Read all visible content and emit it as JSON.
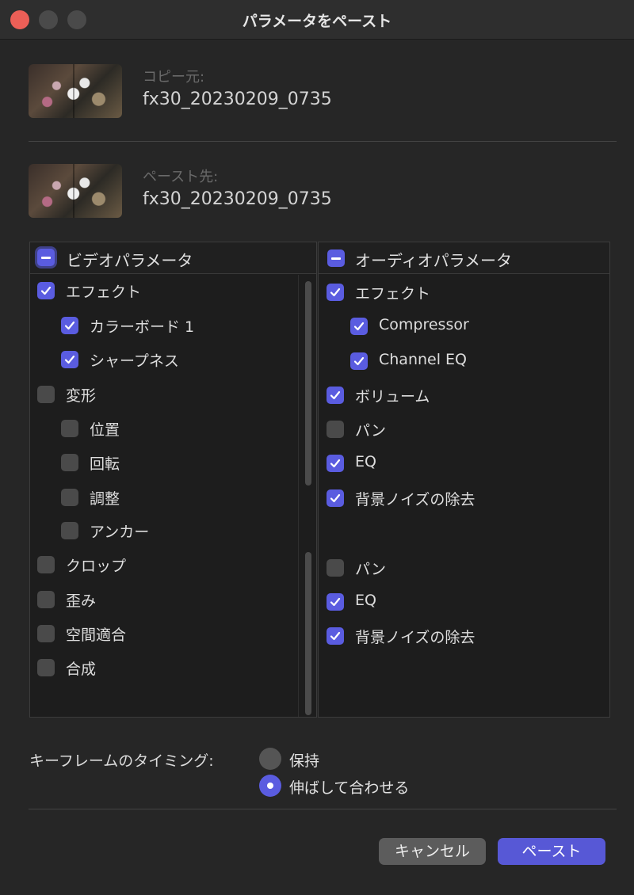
{
  "window": {
    "title": "パラメータをペースト"
  },
  "source": {
    "label": "コピー元:",
    "name": "fx30_20230209_0735"
  },
  "destination": {
    "label": "ペースト先:",
    "name": "fx30_20230209_0735"
  },
  "video": {
    "title": "ビデオパラメータ",
    "state": "mixed",
    "items": [
      {
        "label": "エフェクト",
        "checked": true,
        "level": 0
      },
      {
        "label": "カラーボード 1",
        "checked": true,
        "level": 1
      },
      {
        "label": "シャープネス",
        "checked": true,
        "level": 1
      },
      {
        "label": "変形",
        "checked": false,
        "level": 0
      },
      {
        "label": "位置",
        "checked": false,
        "level": 1
      },
      {
        "label": "回転",
        "checked": false,
        "level": 1
      },
      {
        "label": "調整",
        "checked": false,
        "level": 1
      },
      {
        "label": "アンカー",
        "checked": false,
        "level": 1
      },
      {
        "label": "クロップ",
        "checked": false,
        "level": 0
      },
      {
        "label": "歪み",
        "checked": false,
        "level": 0
      },
      {
        "label": "空間適合",
        "checked": false,
        "level": 0
      },
      {
        "label": "合成",
        "checked": false,
        "level": 0
      }
    ]
  },
  "audio": {
    "title": "オーディオパラメータ",
    "state": "mixed",
    "items": [
      {
        "label": "エフェクト",
        "checked": true,
        "level": 0
      },
      {
        "label": "Compressor",
        "checked": true,
        "level": 1
      },
      {
        "label": "Channel EQ",
        "checked": true,
        "level": 1
      },
      {
        "label": "ボリューム",
        "checked": true,
        "level": 0
      },
      {
        "label": "パン",
        "checked": false,
        "level": 0
      },
      {
        "label": "EQ",
        "checked": true,
        "level": 0
      },
      {
        "label": "背景ノイズの除去",
        "checked": true,
        "level": 0
      },
      {
        "label": "パン",
        "checked": false,
        "level": 0
      },
      {
        "label": "EQ",
        "checked": true,
        "level": 0
      },
      {
        "label": "背景ノイズの除去",
        "checked": true,
        "level": 0
      }
    ]
  },
  "keyframes": {
    "label": "キーフレームのタイミング:",
    "options": [
      {
        "label": "保持",
        "selected": false
      },
      {
        "label": "伸ばして合わせる",
        "selected": true
      }
    ]
  },
  "buttons": {
    "cancel": "キャンセル",
    "paste": "ペースト"
  },
  "colors": {
    "accent": "#5a5ce0",
    "close": "#ec5f57"
  }
}
